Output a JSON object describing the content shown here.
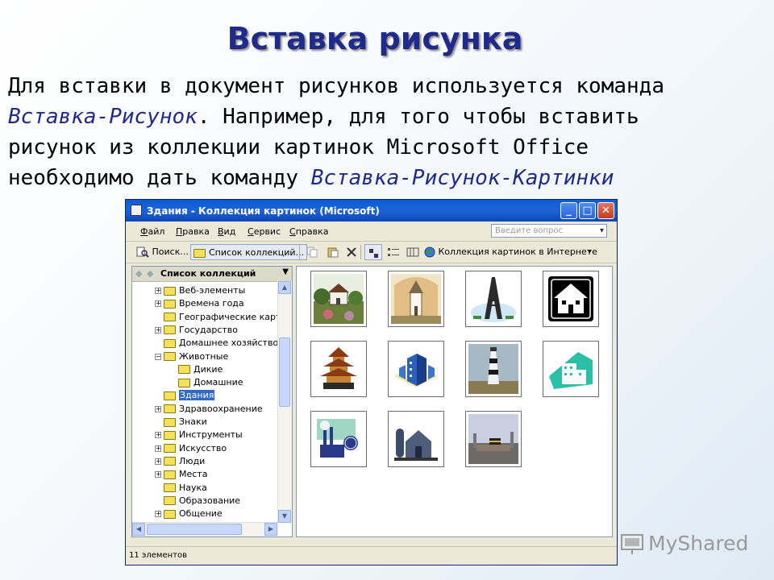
{
  "slide": {
    "title": "Вставка рисунка",
    "line1": "Для вставки в документ рисунков используется команда",
    "line2_cmd": "Вставка-Рисунок",
    "line2_rest": ". Например, для того чтобы вставить",
    "line3": "рисунок из коллекции картинок Microsoft Office",
    "line4_text": "необходимо дать команду ",
    "line4_cmd": "Вставка-Рисунок-Картинки"
  },
  "window": {
    "title": "Здания - Коллекция картинок (Microsoft)",
    "minimize": "_",
    "maximize": "□",
    "close": "✕",
    "menu": [
      {
        "first": "Ф",
        "rest": "айл"
      },
      {
        "first": "П",
        "rest": "равка"
      },
      {
        "first": "В",
        "rest": "ид"
      },
      {
        "first": "С",
        "rest": "ервис"
      },
      {
        "first": "С",
        "rest": "правка"
      }
    ],
    "ask_placeholder": "Введите вопрос",
    "toolbar": {
      "search": "Поиск...",
      "collection_list": "Список коллекций...",
      "web_collection": "Коллекция картинок в Интернете"
    },
    "pane_header": "Список коллекций",
    "tree": [
      {
        "label": "Веб-элементы",
        "level": 0,
        "toggle": "+"
      },
      {
        "label": "Времена года",
        "level": 0,
        "toggle": "+"
      },
      {
        "label": "Географические карт",
        "level": 0,
        "toggle": ""
      },
      {
        "label": "Государство",
        "level": 0,
        "toggle": "+"
      },
      {
        "label": "Домашнее хозяйство",
        "level": 0,
        "toggle": ""
      },
      {
        "label": "Животные",
        "level": 0,
        "toggle": "−"
      },
      {
        "label": "Дикие",
        "level": 1,
        "toggle": ""
      },
      {
        "label": "Домашние",
        "level": 1,
        "toggle": ""
      },
      {
        "label": "Здания",
        "level": 0,
        "toggle": "",
        "selected": true
      },
      {
        "label": "Здравоохранение",
        "level": 0,
        "toggle": "+"
      },
      {
        "label": "Знаки",
        "level": 0,
        "toggle": ""
      },
      {
        "label": "Инструменты",
        "level": 0,
        "toggle": "+"
      },
      {
        "label": "Искусство",
        "level": 0,
        "toggle": "+"
      },
      {
        "label": "Люди",
        "level": 0,
        "toggle": "+"
      },
      {
        "label": "Места",
        "level": 0,
        "toggle": "+"
      },
      {
        "label": "Наука",
        "level": 0,
        "toggle": ""
      },
      {
        "label": "Образование",
        "level": 0,
        "toggle": ""
      },
      {
        "label": "Общение",
        "level": 0,
        "toggle": "+"
      }
    ],
    "thumbnails": [
      "house-landscape-icon",
      "church-icon",
      "eiffel-tower-icon",
      "house-sign-icon",
      "pagoda-icon",
      "office-building-icon",
      "lighthouse-icon",
      "city-skyline-icon",
      "factory-globe-icon",
      "barn-silo-icon",
      "city-skyline-photo-icon"
    ],
    "status": "11 элементов"
  },
  "watermark": "MyShared"
}
